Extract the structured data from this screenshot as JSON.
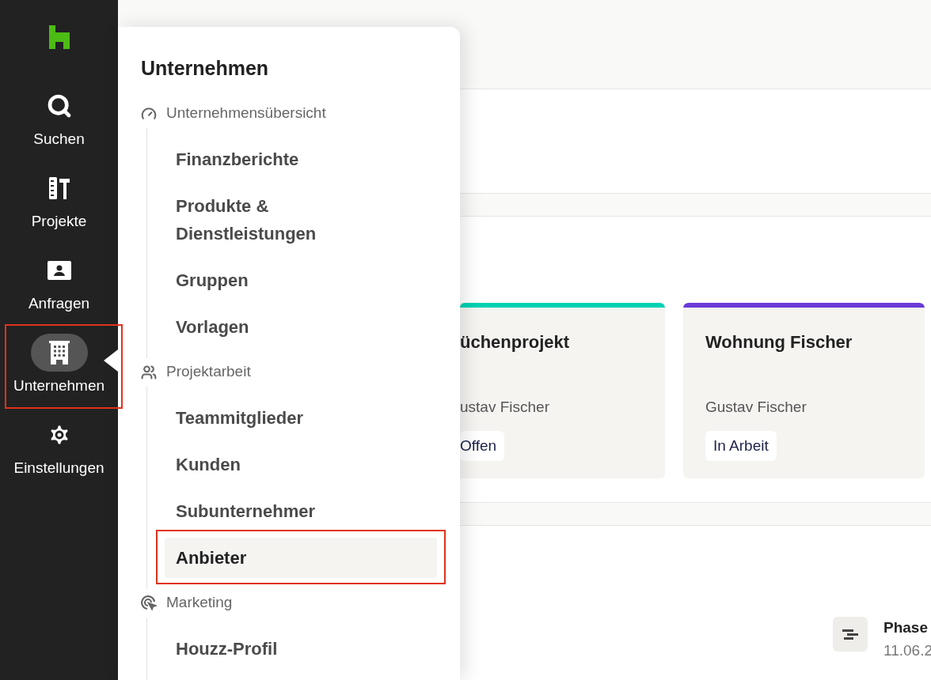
{
  "nav": [
    {
      "label": "Suchen",
      "kind": "search",
      "selected": false,
      "highlighted": false
    },
    {
      "label": "Projekte",
      "kind": "tools",
      "selected": false,
      "highlighted": false
    },
    {
      "label": "Anfragen",
      "kind": "contact",
      "selected": false,
      "highlighted": false
    },
    {
      "label": "Unternehmen",
      "kind": "building",
      "selected": true,
      "highlighted": true
    },
    {
      "label": "Einstellungen",
      "kind": "settings",
      "selected": false,
      "highlighted": false
    }
  ],
  "menu": {
    "title": "Unternehmen",
    "sections": [
      {
        "label": "Unternehmensübersicht",
        "kind": "gauge",
        "items": [
          {
            "label": "Finanzberichte",
            "selected": false,
            "highlighted": false
          },
          {
            "label": "Produkte & Dienstleistungen",
            "selected": false,
            "highlighted": false
          },
          {
            "label": "Gruppen",
            "selected": false,
            "highlighted": false
          },
          {
            "label": "Vorlagen",
            "selected": false,
            "highlighted": false
          }
        ]
      },
      {
        "label": "Projektarbeit",
        "kind": "users",
        "items": [
          {
            "label": "Teammitglieder",
            "selected": false,
            "highlighted": false
          },
          {
            "label": "Kunden",
            "selected": false,
            "highlighted": false
          },
          {
            "label": "Subunternehmer",
            "selected": false,
            "highlighted": false
          },
          {
            "label": "Anbieter",
            "selected": true,
            "highlighted": true
          }
        ]
      },
      {
        "label": "Marketing",
        "kind": "target",
        "items": [
          {
            "label": "Houzz-Profil",
            "selected": false,
            "highlighted": false
          }
        ]
      }
    ]
  },
  "projects": [
    {
      "title": "üchenprojekt",
      "client": "ustav Fischer",
      "status": "Offen",
      "color": "#00d1b2"
    },
    {
      "title": "Wohnung Fischer",
      "client": "Gustav Fischer",
      "status": "In Arbeit",
      "color": "#6c3bd9"
    }
  ],
  "phase": {
    "title": "Phase",
    "date": "11.06.2"
  }
}
